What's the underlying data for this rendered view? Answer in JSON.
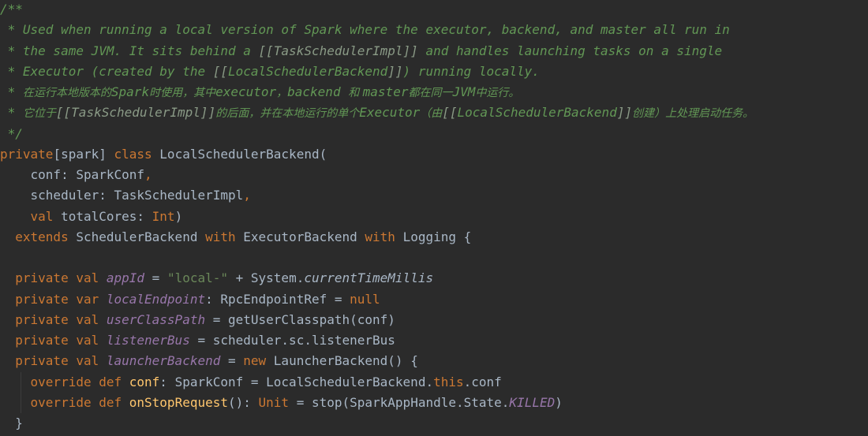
{
  "editor": {
    "language": "Scala",
    "lines": [
      [
        {
          "t": "/**",
          "c": "tok-comment"
        }
      ],
      [
        {
          "t": " * Used when running a local version of Spark where the executor, backend, and master all run in",
          "c": "tok-comment"
        }
      ],
      [
        {
          "t": " * the same JVM. It sits behind a ",
          "c": "tok-comment"
        },
        {
          "t": "[[TaskSchedulerImpl]]",
          "c": "tok-comment-ref"
        },
        {
          "t": " and handles launching tasks on a single",
          "c": "tok-comment"
        }
      ],
      [
        {
          "t": " * Executor (created by the ",
          "c": "tok-comment"
        },
        {
          "t": "[[",
          "c": "tok-comment-ref"
        },
        {
          "t": "LocalSchedulerBackend",
          "c": "tok-comment-tag"
        },
        {
          "t": "]]",
          "c": "tok-comment-ref"
        },
        {
          "t": ") running locally.",
          "c": "tok-comment"
        }
      ],
      [
        {
          "t": " * ",
          "c": "tok-comment"
        },
        {
          "t": "在运行本地版本的",
          "c": "tok-comment tok-cjk"
        },
        {
          "t": "Spark",
          "c": "tok-comment"
        },
        {
          "t": "时使用，其中",
          "c": "tok-comment tok-cjk"
        },
        {
          "t": "executor",
          "c": "tok-comment"
        },
        {
          "t": "，",
          "c": "tok-comment tok-cjk"
        },
        {
          "t": "backend ",
          "c": "tok-comment"
        },
        {
          "t": "和 ",
          "c": "tok-comment tok-cjk"
        },
        {
          "t": "master",
          "c": "tok-comment"
        },
        {
          "t": "都在同一",
          "c": "tok-comment tok-cjk"
        },
        {
          "t": "JVM",
          "c": "tok-comment"
        },
        {
          "t": "中运行。",
          "c": "tok-comment tok-cjk"
        }
      ],
      [
        {
          "t": " * ",
          "c": "tok-comment"
        },
        {
          "t": "它位于",
          "c": "tok-comment tok-cjk"
        },
        {
          "t": "[[TaskSchedulerImpl]]",
          "c": "tok-comment-ref"
        },
        {
          "t": "的后面，并在本地运行的单个",
          "c": "tok-comment tok-cjk"
        },
        {
          "t": "Executor",
          "c": "tok-comment"
        },
        {
          "t": "（由",
          "c": "tok-comment tok-cjk"
        },
        {
          "t": "[[",
          "c": "tok-comment-ref"
        },
        {
          "t": "LocalSchedulerBackend",
          "c": "tok-comment-tag"
        },
        {
          "t": "]]",
          "c": "tok-comment-ref"
        },
        {
          "t": "创建）上处理启动任务。",
          "c": "tok-comment tok-cjk"
        }
      ],
      [
        {
          "t": " */",
          "c": "tok-comment"
        }
      ],
      [
        {
          "t": "private",
          "c": "tok-kw"
        },
        {
          "t": "[spark] ",
          "c": "tok-plain"
        },
        {
          "t": "class ",
          "c": "tok-kw"
        },
        {
          "t": "LocalSchedulerBackend(",
          "c": "tok-plain"
        }
      ],
      [
        {
          "t": "    conf: SparkConf",
          "c": "tok-plain"
        },
        {
          "t": ",",
          "c": "tok-kw"
        }
      ],
      [
        {
          "t": "    scheduler: TaskSchedulerImpl",
          "c": "tok-plain"
        },
        {
          "t": ",",
          "c": "tok-kw"
        }
      ],
      [
        {
          "t": "    ",
          "c": "tok-plain"
        },
        {
          "t": "val ",
          "c": "tok-kw"
        },
        {
          "t": "totalCores: ",
          "c": "tok-plain"
        },
        {
          "t": "Int",
          "c": "tok-kw"
        },
        {
          "t": ")",
          "c": "tok-plain"
        }
      ],
      [
        {
          "t": "  ",
          "c": "tok-plain"
        },
        {
          "t": "extends ",
          "c": "tok-kw"
        },
        {
          "t": "SchedulerBackend ",
          "c": "tok-plain"
        },
        {
          "t": "with ",
          "c": "tok-kw"
        },
        {
          "t": "ExecutorBackend ",
          "c": "tok-plain"
        },
        {
          "t": "with ",
          "c": "tok-kw"
        },
        {
          "t": "Logging {",
          "c": "tok-plain"
        }
      ],
      [],
      [
        {
          "t": "  ",
          "c": "tok-plain"
        },
        {
          "t": "private val ",
          "c": "tok-kw"
        },
        {
          "t": "appId",
          "c": "tok-field"
        },
        {
          "t": " = ",
          "c": "tok-plain"
        },
        {
          "t": "\"local-\"",
          "c": "tok-str"
        },
        {
          "t": " + System.",
          "c": "tok-plain"
        },
        {
          "t": "currentTimeMillis",
          "c": "tok-method-it"
        }
      ],
      [
        {
          "t": "  ",
          "c": "tok-plain"
        },
        {
          "t": "private var ",
          "c": "tok-kw"
        },
        {
          "t": "localEndpoint",
          "c": "tok-field"
        },
        {
          "t": ": RpcEndpointRef = ",
          "c": "tok-plain"
        },
        {
          "t": "null",
          "c": "tok-kw"
        }
      ],
      [
        {
          "t": "  ",
          "c": "tok-plain"
        },
        {
          "t": "private val ",
          "c": "tok-kw"
        },
        {
          "t": "userClassPath",
          "c": "tok-field"
        },
        {
          "t": " = getUserClasspath(conf)",
          "c": "tok-plain"
        }
      ],
      [
        {
          "t": "  ",
          "c": "tok-plain"
        },
        {
          "t": "private val ",
          "c": "tok-kw"
        },
        {
          "t": "listenerBus",
          "c": "tok-field"
        },
        {
          "t": " = scheduler.sc.listenerBus",
          "c": "tok-plain"
        }
      ],
      [
        {
          "t": "  ",
          "c": "tok-plain"
        },
        {
          "t": "private val ",
          "c": "tok-kw"
        },
        {
          "t": "launcherBackend",
          "c": "tok-field"
        },
        {
          "t": " = ",
          "c": "tok-plain"
        },
        {
          "t": "new ",
          "c": "tok-kw"
        },
        {
          "t": "LauncherBackend() {",
          "c": "tok-plain"
        }
      ],
      [
        {
          "t": "    ",
          "c": "tok-plain"
        },
        {
          "t": "override def ",
          "c": "tok-kw"
        },
        {
          "t": "conf",
          "c": "tok-fn"
        },
        {
          "t": ": SparkConf = LocalSchedulerBackend.",
          "c": "tok-plain"
        },
        {
          "t": "this",
          "c": "tok-kw"
        },
        {
          "t": ".conf",
          "c": "tok-plain"
        }
      ],
      [
        {
          "t": "    ",
          "c": "tok-plain"
        },
        {
          "t": "override def ",
          "c": "tok-kw"
        },
        {
          "t": "onStopRequest",
          "c": "tok-fn"
        },
        {
          "t": "(): ",
          "c": "tok-plain"
        },
        {
          "t": "Unit",
          "c": "tok-kw"
        },
        {
          "t": " = stop(SparkAppHandle.State.",
          "c": "tok-plain"
        },
        {
          "t": "KILLED",
          "c": "tok-const"
        },
        {
          "t": ")",
          "c": "tok-plain"
        }
      ],
      [
        {
          "t": "  }",
          "c": "tok-plain"
        }
      ]
    ]
  }
}
